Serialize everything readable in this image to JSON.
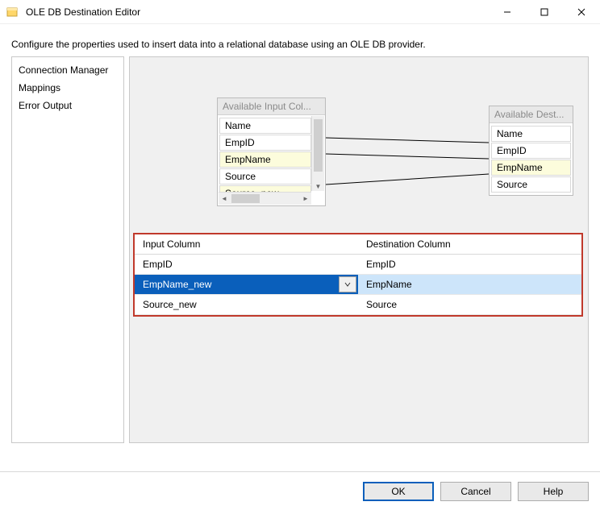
{
  "window": {
    "title": "OLE DB Destination Editor",
    "subtitle": "Configure the properties used to insert data into a relational database using an OLE DB provider."
  },
  "nav": {
    "items": [
      {
        "label": "Connection Manager"
      },
      {
        "label": "Mappings"
      },
      {
        "label": "Error Output"
      }
    ]
  },
  "inputList": {
    "title": "Available Input Col...",
    "rows": [
      {
        "label": "Name",
        "highlight": false
      },
      {
        "label": "EmpID",
        "highlight": false
      },
      {
        "label": "EmpName",
        "highlight": true
      },
      {
        "label": "Source",
        "highlight": false
      },
      {
        "label": "Source_new",
        "highlight": true
      }
    ]
  },
  "destList": {
    "title": "Available Dest...",
    "rows": [
      {
        "label": "Name",
        "highlight": false
      },
      {
        "label": "EmpID",
        "highlight": false
      },
      {
        "label": "EmpName",
        "highlight": true
      },
      {
        "label": "Source",
        "highlight": false
      }
    ]
  },
  "grid": {
    "headers": {
      "input": "Input Column",
      "dest": "Destination Column"
    },
    "rows": [
      {
        "input": "EmpID",
        "dest": "EmpID",
        "selected": false
      },
      {
        "input": "EmpName_new",
        "dest": "EmpName",
        "selected": true
      },
      {
        "input": "Source_new",
        "dest": "Source",
        "selected": false
      }
    ]
  },
  "buttons": {
    "ok": "OK",
    "cancel": "Cancel",
    "help": "Help"
  }
}
